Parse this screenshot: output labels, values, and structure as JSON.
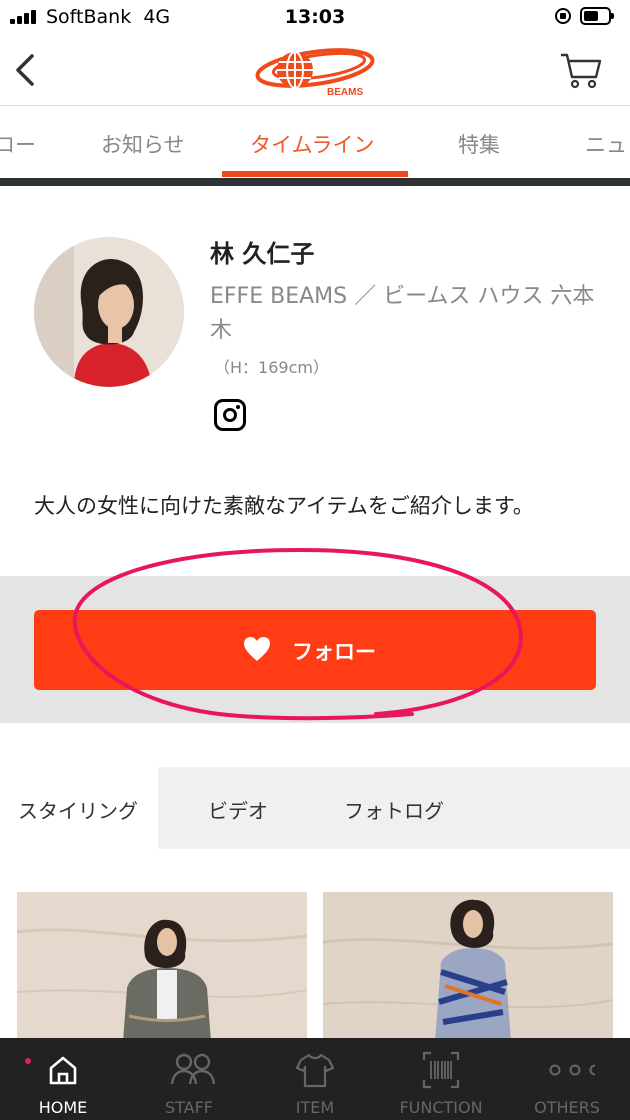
{
  "status_bar": {
    "carrier": "SoftBank",
    "network": "4G",
    "time": "13:03"
  },
  "header": {
    "logo_text": "BEAMS",
    "back_icon": "chevron-left-icon",
    "cart_icon": "cart-icon"
  },
  "tabs": [
    {
      "label": "ロー"
    },
    {
      "label": "お知らせ"
    },
    {
      "label": "タイムライン",
      "active": true
    },
    {
      "label": "特集"
    },
    {
      "label": "ニュ"
    }
  ],
  "profile": {
    "name": "林 久仁子",
    "shop": "EFFE BEAMS ／ ビームス ハウス 六本木",
    "height": "（H：169cm）",
    "bio": "大人の女性に向けた素敵なアイテムをご紹介します。"
  },
  "follow": {
    "label": "フォロー",
    "icon": "heart-icon"
  },
  "content_tabs": [
    {
      "label": "スタイリング",
      "active": true
    },
    {
      "label": "ビデオ"
    },
    {
      "label": "フォトログ"
    }
  ],
  "bottom_nav": [
    {
      "label": "HOME",
      "icon": "home-icon",
      "active": true
    },
    {
      "label": "STAFF",
      "icon": "staff-icon"
    },
    {
      "label": "ITEM",
      "icon": "tshirt-icon"
    },
    {
      "label": "FUNCTION",
      "icon": "barcode-icon"
    },
    {
      "label": "OTHERS",
      "icon": "more-icon"
    }
  ],
  "colors": {
    "accent": "#ff3c14",
    "tab_active": "#ee5a2a",
    "annotation": "#e8175d",
    "nav_bg": "#222222"
  }
}
